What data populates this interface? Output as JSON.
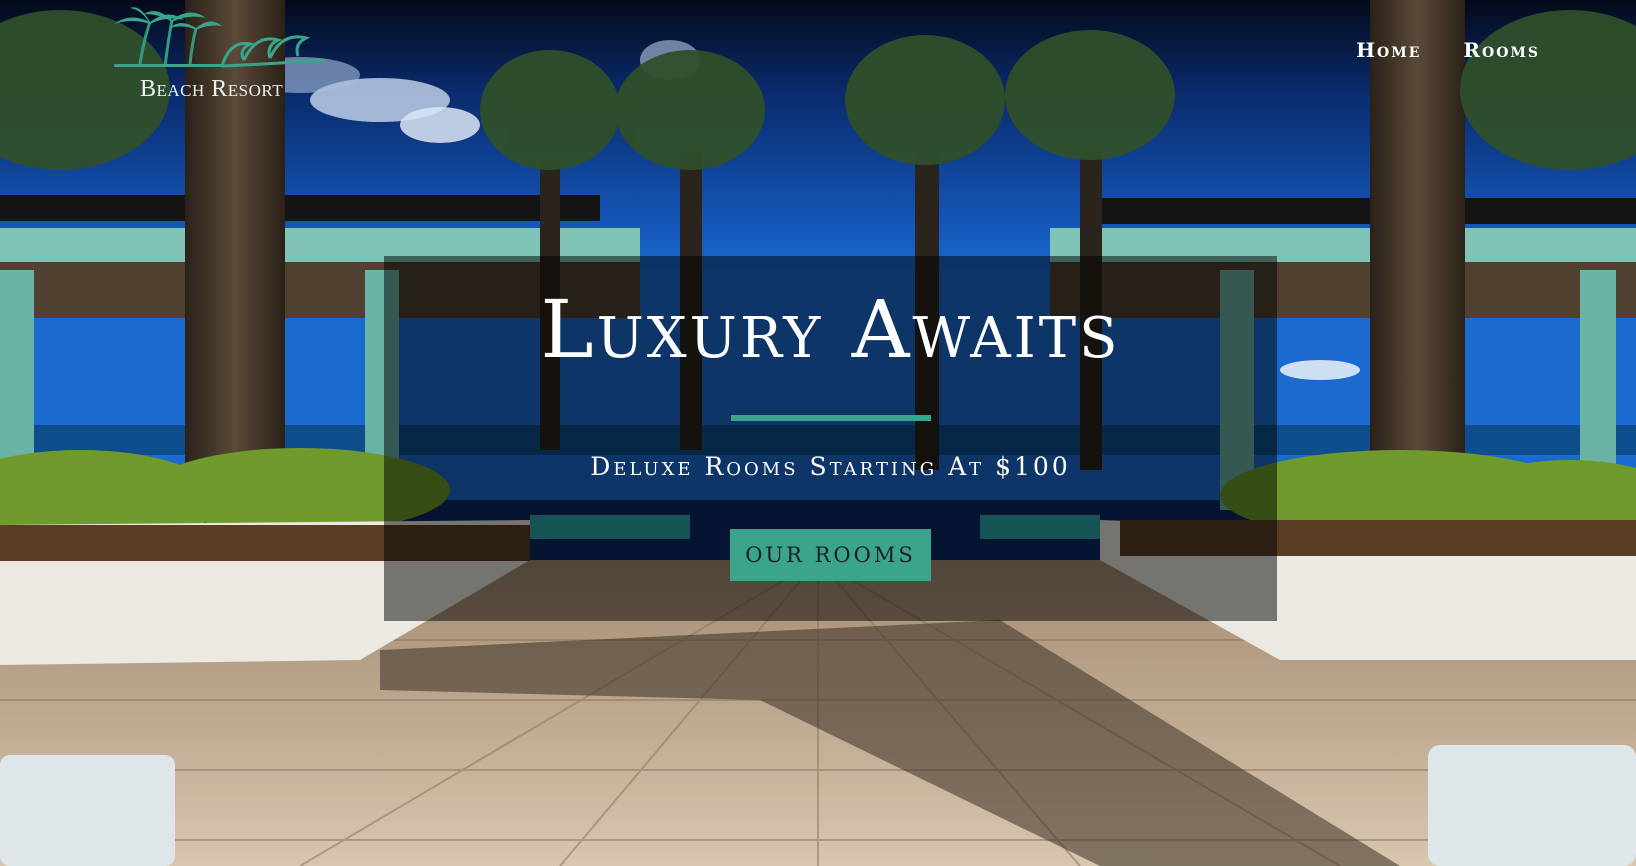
{
  "brand": {
    "name": "Beach Resort",
    "logo_icon": "palm-trees-wave-logo",
    "accent_color": "#3aa58b"
  },
  "nav": {
    "items": [
      {
        "label": "Home"
      },
      {
        "label": "Rooms"
      }
    ]
  },
  "hero": {
    "background": "resort-pool-deck-palms-photo",
    "title": "Luxury Awaits",
    "subtitle": "Deluxe Rooms Starting At $100",
    "button_label": "OUR ROOMS"
  }
}
